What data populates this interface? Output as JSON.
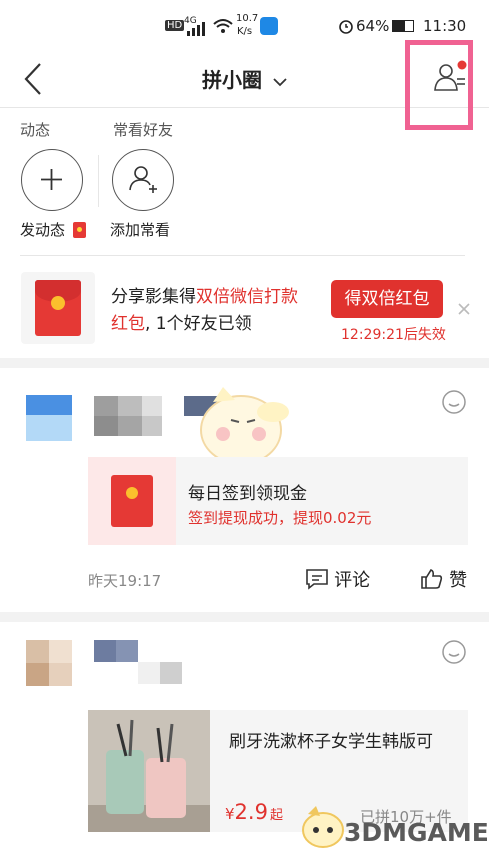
{
  "status_bar": {
    "network": "4G",
    "speed": "10.7",
    "speed_unit": "K/s",
    "battery": "64%",
    "time": "11:30"
  },
  "nav": {
    "title": "拼小圈"
  },
  "sections": {
    "feed_label": "动态",
    "friends_label": "常看好友",
    "post_label": "发动态",
    "add_friend_label": "添加常看"
  },
  "banner": {
    "text_prefix": "分享影集得",
    "text_highlight": "双倍微信打款红包",
    "text_suffix": ", 1个好友已领",
    "button_label": "得双倍红包",
    "countdown": "12:29:21后失效"
  },
  "posts": [
    {
      "card_title": "每日签到领现金",
      "card_subtitle": "签到提现成功，提现0.02元",
      "time": "昨天19:17",
      "comment_label": "评论",
      "like_label": "赞"
    },
    {
      "product_title": "刷牙洗漱杯子女学生韩版可",
      "currency": "¥",
      "price": "2.9",
      "price_suffix": "起",
      "sold": "已拼10万+件"
    }
  ],
  "watermark": "3DMGAME",
  "colors": {
    "accent": "#e0322e",
    "highlight_box": "#f06292"
  }
}
